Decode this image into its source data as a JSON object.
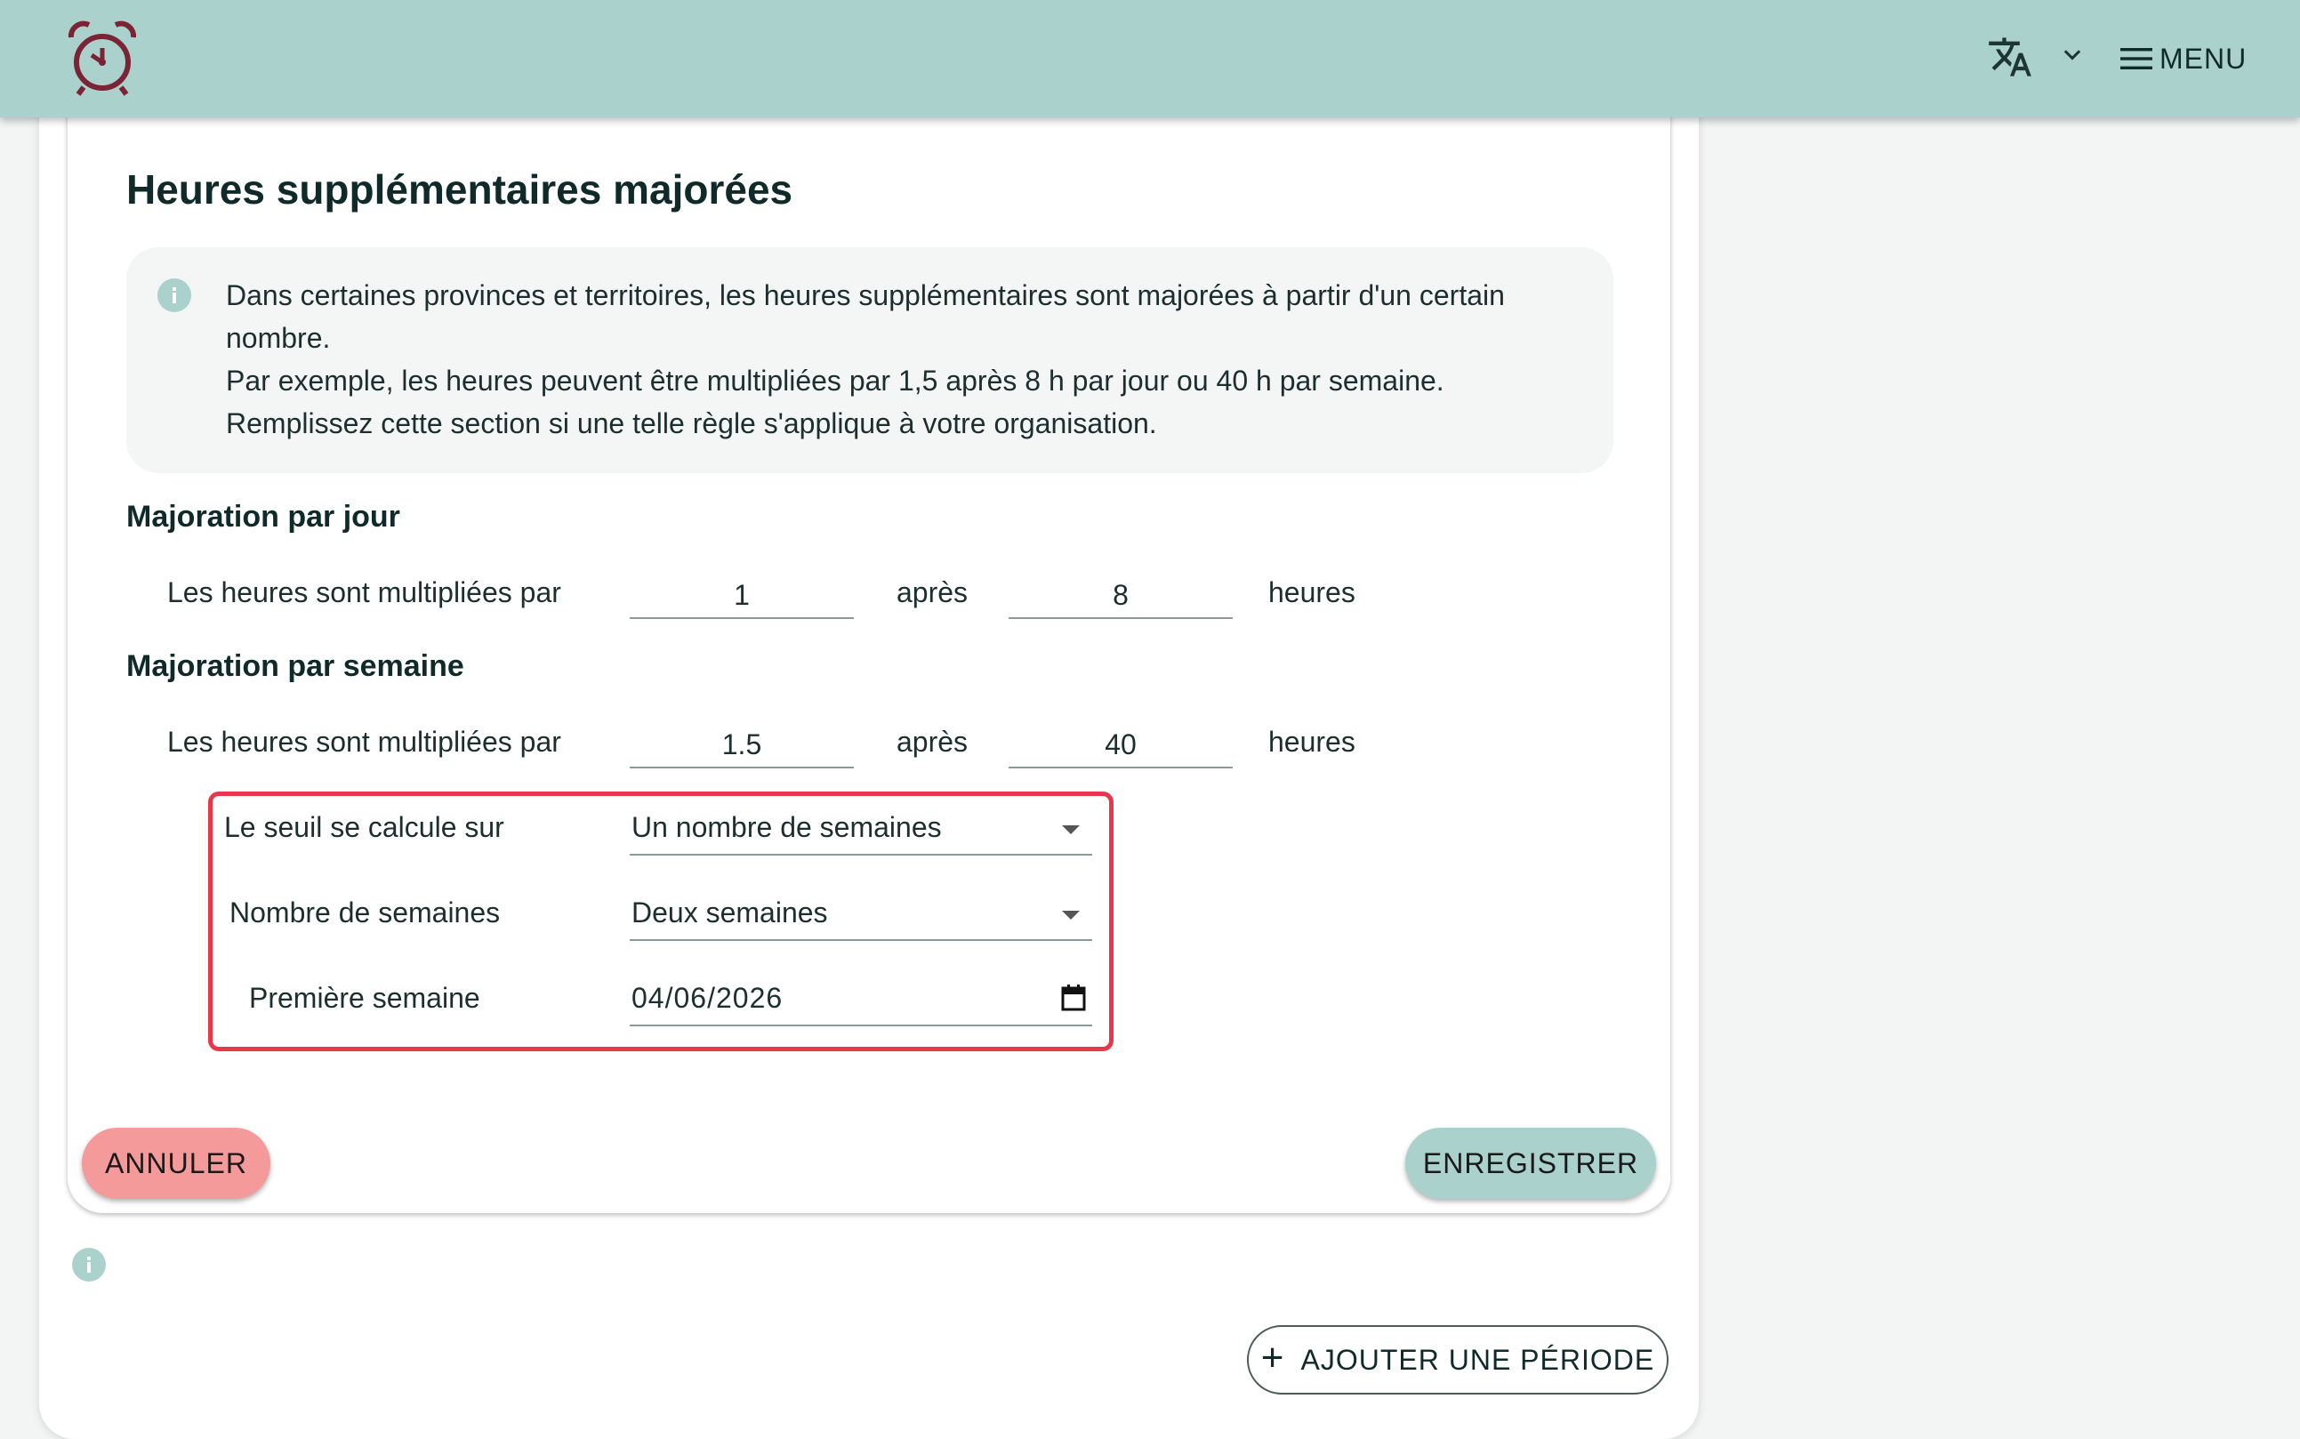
{
  "header": {
    "logo_icon": "alarm-clock-icon",
    "language_icon": "translate-icon",
    "menu_label": "MENU"
  },
  "section": {
    "title": "Heures supplémentaires majorées",
    "info_lines": [
      "Dans certaines provinces et territoires, les heures supplémentaires sont majorées à partir d'un certain",
      "nombre.",
      "Par exemple, les heures peuvent être multipliées par 1,5 après 8 h par jour ou 40 h par semaine.",
      "Remplissez cette section si une telle règle s'applique à votre organisation."
    ]
  },
  "daily": {
    "heading": "Majoration par jour",
    "label": "Les heures sont multipliées par",
    "multiplier": "1",
    "after_label": "après",
    "hours": "8",
    "unit_label": "heures"
  },
  "weekly": {
    "heading": "Majoration par semaine",
    "label": "Les heures sont multipliées par",
    "multiplier": "1.5",
    "after_label": "après",
    "hours": "40",
    "unit_label": "heures",
    "threshold_label": "Le seuil se calcule sur",
    "threshold_value": "Un nombre de semaines",
    "weeks_label": "Nombre de semaines",
    "weeks_value": "Deux semaines",
    "first_week_label": "Première semaine",
    "first_week_value": "04/06/2026"
  },
  "actions": {
    "cancel": "ANNULER",
    "save": "ENREGISTRER",
    "add_period": "AJOUTER UNE PÉRIODE"
  },
  "colors": {
    "header_bg": "#abd1cd",
    "cancel_bg": "#f59a9a",
    "save_bg": "#abd1cd",
    "highlight_border": "#e8364a"
  }
}
